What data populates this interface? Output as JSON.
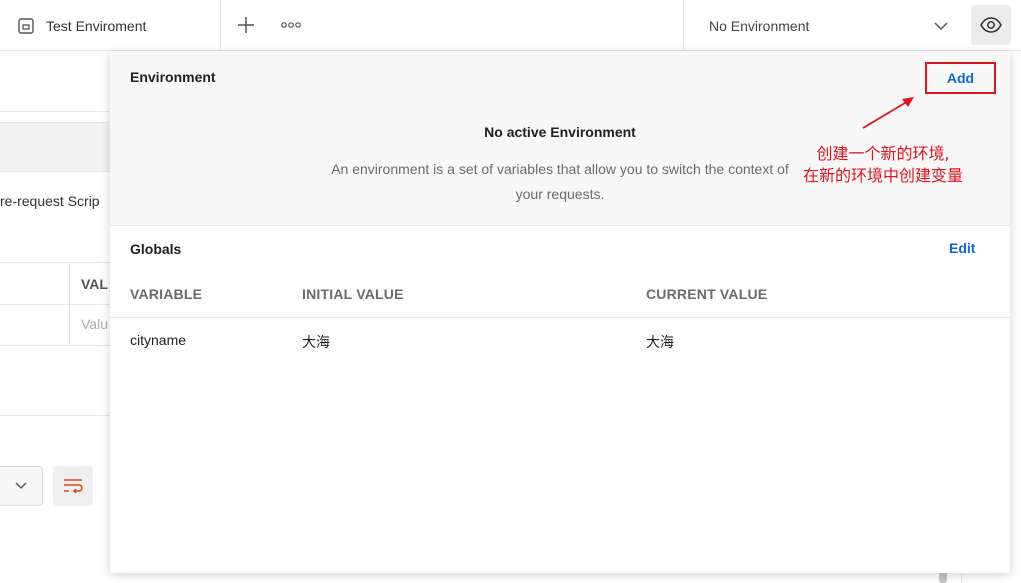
{
  "topbar": {
    "tab_label": "Test Enviroment",
    "env_select_value": "No Environment"
  },
  "background": {
    "script_fragment": "re-request Scrip",
    "value_header": "VAL",
    "value_placeholder": "Valu"
  },
  "popover": {
    "environment": {
      "title": "Environment",
      "add_label": "Add",
      "empty_title": "No active Environment",
      "empty_description": "An environment is a set of variables that allow you to switch the context of your requests."
    },
    "globals": {
      "title": "Globals",
      "edit_label": "Edit",
      "columns": [
        "VARIABLE",
        "INITIAL VALUE",
        "CURRENT VALUE"
      ],
      "rows": [
        [
          "cityname",
          "大海",
          "大海"
        ]
      ]
    }
  },
  "annotation": {
    "line1": "创建一个新的环境,",
    "line2": "在新的环境中创建变量",
    "color": "#e0141e"
  },
  "colors": {
    "link_blue": "#0b68d4",
    "annotation_red": "#e0141e"
  }
}
